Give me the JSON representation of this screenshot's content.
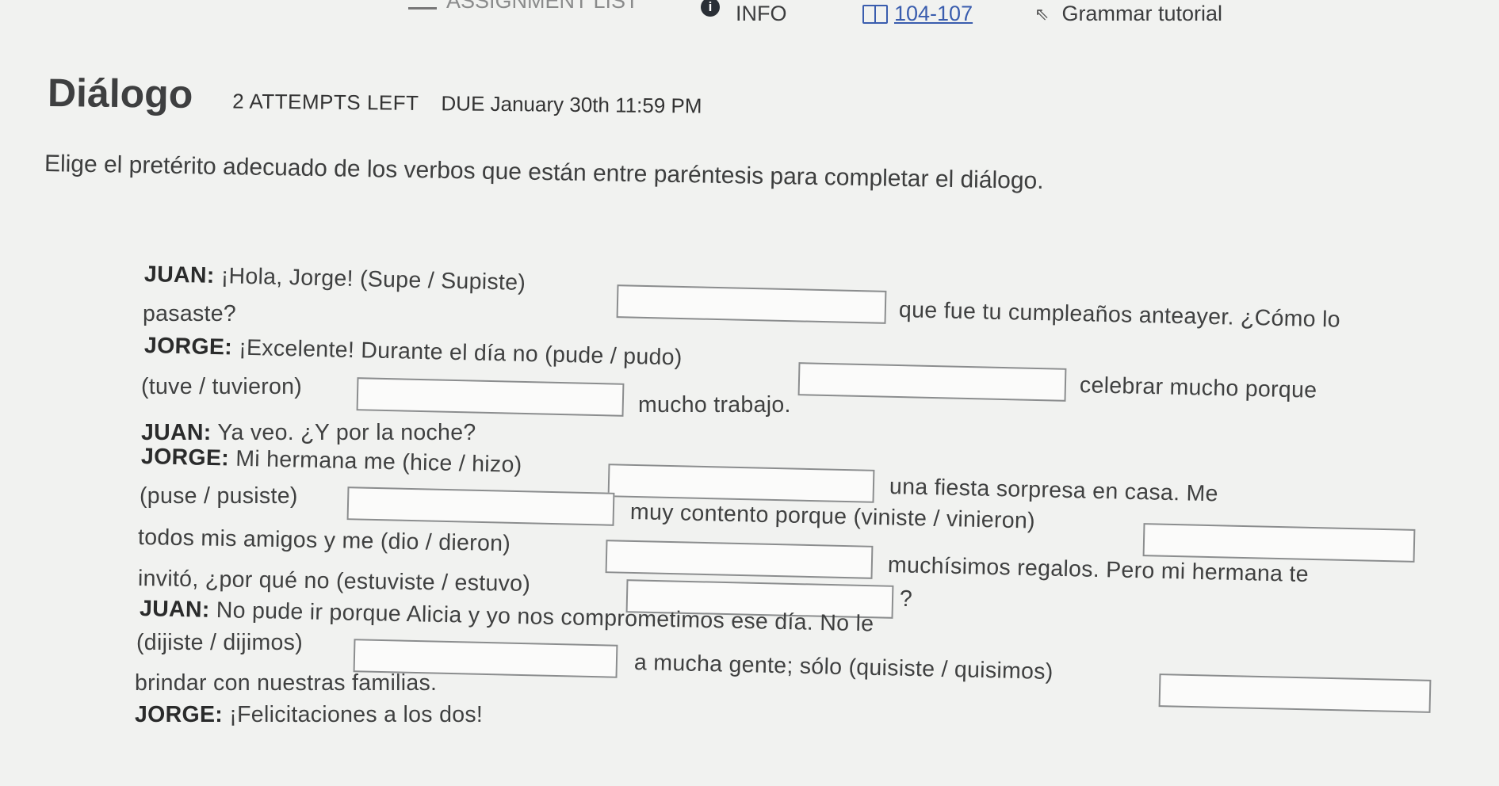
{
  "nav": {
    "assignment_list": "ASSIGNMENT LIST",
    "info": "INFO",
    "pages": "104-107",
    "grammar": "Grammar tutorial"
  },
  "header": {
    "title": "Diálogo",
    "attempts": "2 ATTEMPTS LEFT",
    "due": "DUE  January 30th 11:59 PM"
  },
  "instructions": "Elige el pretérito adecuado de los verbos que están entre paréntesis para completar el diálogo.",
  "dialog": {
    "l1": {
      "speaker": "JUAN:",
      "a": "¡Hola, Jorge! (Supe / Supiste)",
      "b": "que fue tu cumpleaños anteayer. ¿Cómo lo"
    },
    "l2": {
      "a": "pasaste?"
    },
    "l3": {
      "speaker": "JORGE:",
      "a": "¡Excelente! Durante el día no (pude / pudo)",
      "b": "celebrar mucho porque"
    },
    "l4": {
      "a": "(tuve / tuvieron)",
      "b": "mucho trabajo."
    },
    "l5": {
      "speaker": "JUAN:",
      "a": "Ya veo. ¿Y por la noche?"
    },
    "l6": {
      "speaker": "JORGE:",
      "a": "Mi hermana me (hice / hizo)",
      "b": "una fiesta sorpresa en casa. Me"
    },
    "l7": {
      "a": "(puse / pusiste)",
      "b": "muy contento porque (viniste / vinieron)"
    },
    "l8": {
      "a": "todos mis amigos y me (dio / dieron)",
      "b": "muchísimos regalos. Pero mi hermana te"
    },
    "l9": {
      "a": "invitó, ¿por qué no (estuviste / estuvo)",
      "b": "?"
    },
    "l10": {
      "speaker": "JUAN:",
      "a": "No pude ir porque Alicia y yo nos comprometimos ese día. No le"
    },
    "l11": {
      "a": "(dijiste / dijimos)",
      "b": "a mucha gente; sólo (quisiste / quisimos)"
    },
    "l12": {
      "a": "brindar con nuestras familias."
    },
    "l13": {
      "speaker": "JORGE:",
      "a": "¡Felicitaciones a los dos!"
    }
  },
  "answers": [
    "",
    "",
    "",
    "",
    "",
    "",
    "",
    "",
    "",
    ""
  ]
}
